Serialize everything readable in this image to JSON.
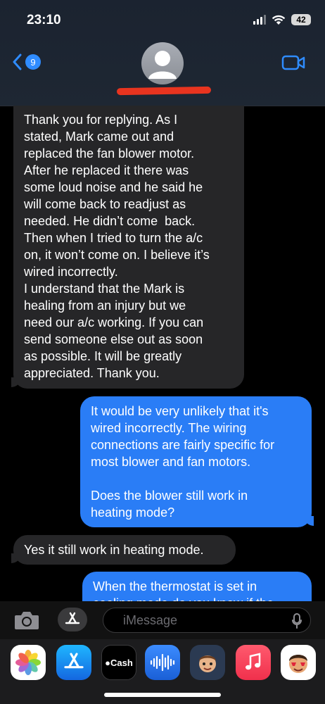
{
  "status_bar": {
    "time": "23:10",
    "battery": "42"
  },
  "header": {
    "unread_count": "9"
  },
  "messages": [
    {
      "direction": "incoming",
      "text": "Thank you for replying. As I\nstated, Mark came out and\nreplaced the fan blower motor.\nAfter he replaced it there was\nsome loud noise and he said he\nwill come back to readjust as\nneeded. He didn’t come  back.\nThen when I tried to turn the a/c\non, it won’t come on. I believe it’s\nwired incorrectly.\nI understand that the Mark is\nhealing from an injury but we\nneed our a/c working. If you can\nsend someone else out as soon\nas possible. It will be greatly\nappreciated. Thank you."
    },
    {
      "direction": "outgoing",
      "text": "It would be very unlikely that it's\nwired incorrectly. The wiring\nconnections are fairly specific for\nmost blower and fan motors.\n\nDoes the blower still work in\nheating mode?"
    },
    {
      "direction": "incoming",
      "text": "Yes it still work in heating mode."
    },
    {
      "direction": "outgoing",
      "text": "When the thermostat is set in\ncooling mode do you know if the"
    }
  ],
  "input": {
    "placeholder": "iMessage"
  },
  "app_drawer": {
    "apps": [
      {
        "name": "Photos",
        "icon": "photos-icon"
      },
      {
        "name": "App Store",
        "icon": "appstore-icon"
      },
      {
        "name": "Cash",
        "label": "Cash",
        "icon": "apple-cash-icon"
      },
      {
        "name": "Audio Message",
        "icon": "audio-message-icon"
      },
      {
        "name": "Memoji",
        "icon": "memoji-icon"
      },
      {
        "name": "Music",
        "icon": "music-icon"
      },
      {
        "name": "Memoji Stickers",
        "icon": "memoji-stickers-icon"
      }
    ]
  },
  "colors": {
    "accent": "#2f8cff",
    "outgoing_bubble": "#2a7df6",
    "incoming_bubble": "#262628",
    "redaction": "#e8341f"
  }
}
